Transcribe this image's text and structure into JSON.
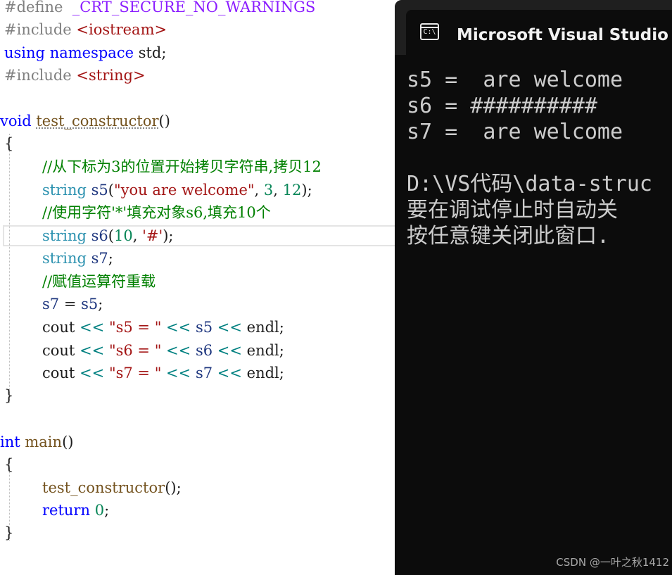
{
  "editor": {
    "define_kw": "#define",
    "define_macro": "_CRT_SECURE_NO_WARNINGS",
    "include_kw": "#include",
    "include_iostream": "<iostream>",
    "using_kw": "using",
    "namespace_kw": "namespace",
    "namespace_rest": " std;",
    "include_string": "<string>",
    "void_kw": "void",
    "fn_test_constructor": "test_constructor",
    "parens": "()",
    "brace_open": "{",
    "brace_close": "}",
    "comment1": "//从下标为3的位置开始拷贝字符串,拷贝12",
    "string_kw": "string",
    "s5_decl": "s5",
    "s5_str": "\"you are welcome\"",
    "num3": "3",
    "num12": "12",
    "comment2": "//使用字符'*'填充对象s6,填充10个",
    "s6_decl": "s6",
    "num10": "10",
    "char_hash": "'#'",
    "s7_decl": "s7",
    "comment3": "//赋值运算符重载",
    "assign_lhs": "s7",
    "assign_rhs": "s5",
    "cout": "cout",
    "shl": "<<",
    "str_s5": "\"s5 = \"",
    "str_s6": "\"s6 = \"",
    "str_s7": "\"s7 = \"",
    "endl": "endl",
    "int_kw": "int",
    "fn_main": "main",
    "call_test": "test_constructor",
    "return_kw": "return",
    "num0": "0"
  },
  "console": {
    "title": "Microsoft Visual Studio 调",
    "icon_text": "C:\\",
    "lines": [
      "s5 =  are welcome",
      "s6 = ##########",
      "s7 =  are welcome",
      "",
      "D:\\VS代码\\data-struc",
      "要在调试停止时自动关",
      "按任意键关闭此窗口."
    ]
  },
  "watermark": "CSDN @一叶之秋1412",
  "colors": {
    "keyword": "#0000ff",
    "type": "#2b91af",
    "comment": "#008000",
    "string": "#a31515",
    "console_bg": "#0c0c0c",
    "console_text": "#cccccc"
  }
}
